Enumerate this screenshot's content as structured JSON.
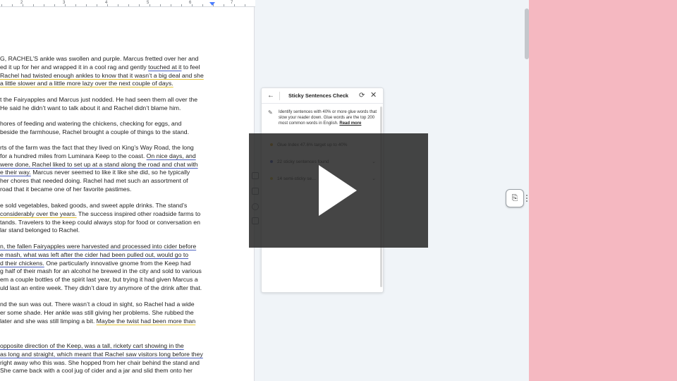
{
  "ruler": {
    "numbers": [
      "2",
      "3",
      "4",
      "5",
      "6",
      "7"
    ]
  },
  "document": {
    "paragraphs": [
      [
        [
          {
            "t": "G, RACHEL’S ankle was swollen and purple. Marcus fretted over her and"
          }
        ],
        [
          {
            "t": "ed it up for her and wrapped it in a cool rag and gently "
          },
          {
            "t": "touched at it",
            "c": "b"
          },
          {
            "t": " to feel"
          }
        ],
        [
          {
            "t": "Rachel had twisted enough ankles to know that it wasn’t a big deal and she",
            "c": "y"
          }
        ],
        [
          {
            "t": "a little slower and a little more lazy over the next couple of days.",
            "c": "y"
          }
        ]
      ],
      [
        [
          {
            "t": "t the Fairyapples and Marcus just nodded. He had seen them all over the"
          }
        ],
        [
          {
            "t": "He said he didn’t want to talk about it and Rachel didn’t blame him."
          }
        ]
      ],
      [
        [
          {
            "t": "hores of feeding and watering the chickens, checking for eggs, and"
          }
        ],
        [
          {
            "t": "beside the farmhouse, Rachel brought a couple of things to the stand."
          }
        ]
      ],
      [
        [
          {
            "t": "rts of the farm was the fact that they lived on King’s Way Road, the long"
          }
        ],
        [
          {
            "t": "for a hundred miles from Luminara Keep to the coast. "
          },
          {
            "t": "On nice days, and",
            "c": "b"
          }
        ],
        [
          {
            "t": "were done, Rachel liked to set up at a stand along the road and chat with",
            "c": "b"
          }
        ],
        [
          {
            "t": "e their way.",
            "c": "b"
          },
          {
            "t": " Marcus never seemed to like it like she did, so he typically"
          }
        ],
        [
          {
            "t": "her chores that needed doing. Rachel had met such an assortment of"
          }
        ],
        [
          {
            "t": "road that it became one of her favorite pastimes."
          }
        ]
      ],
      [
        [
          {
            "t": "e sold vegetables, baked goods, and sweet apple drinks. The stand’s"
          }
        ],
        [
          {
            "t": "considerably over the years.",
            "c": "y"
          },
          {
            "t": " The success inspired other roadside farms to"
          }
        ],
        [
          {
            "t": "tands. Travelers to the keep could always stop for food or conversation en"
          }
        ],
        [
          {
            "t": "lar stand belonged to Rachel."
          }
        ]
      ],
      [
        [
          {
            "t": "n, the fallen Fairyapples were harvested and processed into cider before",
            "c": "b"
          }
        ],
        [
          {
            "t": "e mash, what was left after the cider had been pulled out, would go to",
            "c": "b"
          }
        ],
        [
          {
            "t": "d their chickens.",
            "c": "b"
          },
          {
            "t": " One particularly innovative gnome from the Keep had"
          }
        ],
        [
          {
            "t": "g half of their mash for an alcohol he brewed in the city and sold to various"
          }
        ],
        [
          {
            "t": "em a couple bottles of the spirit last year, but trying it had given Marcus a"
          }
        ],
        [
          {
            "t": "uld last an entire week. They didn’t dare try anymore of the drink after that."
          }
        ]
      ],
      [
        [
          {
            "t": "nd the sun was out. There wasn’t a cloud in sight, so Rachel had a wide"
          }
        ],
        [
          {
            "t": "er some shade. Her ankle was still giving her problems. She rubbed the"
          }
        ],
        [
          {
            "t": "later and she was still limping a bit. "
          },
          {
            "t": "Maybe the twist had been more than",
            "c": "y"
          }
        ]
      ],
      [
        [
          {
            "t": " opposite direction of the Keep, was a tall, rickety cart showing in the",
            "c": "b"
          }
        ],
        [
          {
            "t": "as long and straight, which meant that Rachel saw visitors long before they",
            "c": "b"
          }
        ],
        [
          {
            "t": "right away who this was. She hopped from her chair behind the stand and"
          }
        ],
        [
          {
            "t": "She came back with a cool jug of cider and a jar and slid them onto her"
          }
        ]
      ]
    ]
  },
  "panel": {
    "back_label": "←",
    "title": "Sticky Sentences Check",
    "refresh_label": "⟳",
    "close_label": "✕",
    "pen_label": "✎",
    "description": "Identify sentences with 40% or more glue words that slow your reader down. Glue words are the top 200 most common words in English.",
    "read_more": "Read more",
    "results": [
      {
        "text": "Glue Index 47.6% target up to 40%",
        "color": "#e0a020",
        "chevron": ""
      },
      {
        "text": "22 sticky sentences found",
        "color": "#4a5fc1",
        "chevron": "⌄"
      },
      {
        "text": "14 semi-sticky se…",
        "color": "#e6c63a",
        "chevron": "⌄"
      }
    ]
  },
  "float_button": {
    "icon_label": "⎘"
  },
  "video": {
    "play_label": "Play"
  },
  "colors": {
    "yellow_underline": "#e6c63a",
    "blue_underline": "#4a5fc1",
    "background_pink": "#f5b8c1"
  }
}
